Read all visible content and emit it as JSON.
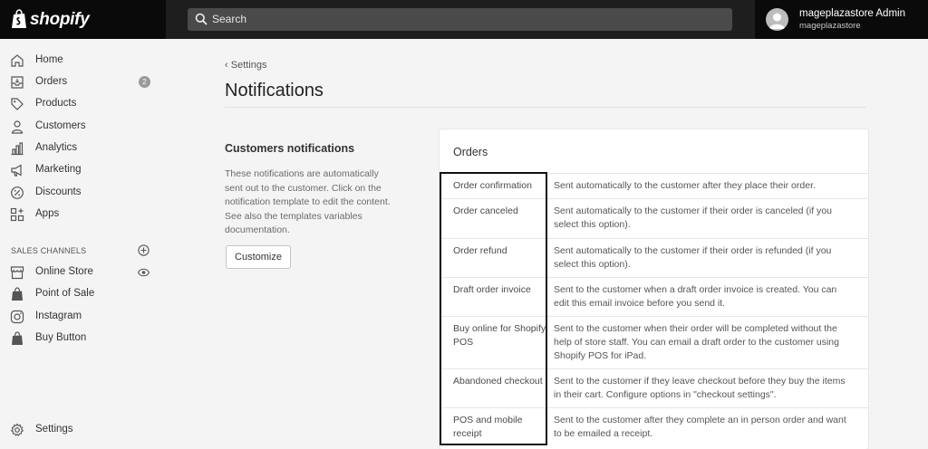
{
  "brand": {
    "name": "shopify"
  },
  "search": {
    "placeholder": "Search"
  },
  "user": {
    "name": "mageplazastore Admin",
    "store": "mageplazastore"
  },
  "sidebar": {
    "items": [
      {
        "label": "Home",
        "icon": "home-icon"
      },
      {
        "label": "Orders",
        "icon": "orders-icon",
        "badge": "2"
      },
      {
        "label": "Products",
        "icon": "tag-icon"
      },
      {
        "label": "Customers",
        "icon": "person-icon"
      },
      {
        "label": "Analytics",
        "icon": "bar-chart-icon"
      },
      {
        "label": "Marketing",
        "icon": "megaphone-icon"
      },
      {
        "label": "Discounts",
        "icon": "discount-icon"
      },
      {
        "label": "Apps",
        "icon": "apps-icon"
      }
    ],
    "sales_channels_label": "SALES CHANNELS",
    "channels": [
      {
        "label": "Online Store",
        "icon": "store-icon"
      },
      {
        "label": "Point of Sale",
        "icon": "pos-bag-icon"
      },
      {
        "label": "Instagram",
        "icon": "instagram-icon"
      },
      {
        "label": "Buy Button",
        "icon": "buy-button-icon"
      }
    ],
    "settings_label": "Settings"
  },
  "main": {
    "breadcrumb": "Settings",
    "title": "Notifications",
    "customers_section": {
      "title": "Customers notifications",
      "description": "These notifications are automatically sent out to the customer. Click on the notification template to edit the content. See also the templates variables documentation.",
      "customize_label": "Customize"
    },
    "orders_card": {
      "title": "Orders",
      "rows": [
        {
          "name": "Order confirmation",
          "desc": "Sent automatically to the customer after they place their order."
        },
        {
          "name": "Order canceled",
          "desc": "Sent automatically to the customer if their order is canceled (if you select this option)."
        },
        {
          "name": "Order refund",
          "desc": "Sent automatically to the customer if their order is refunded (if you select this option)."
        },
        {
          "name": "Draft order invoice",
          "desc": "Sent to the customer when a draft order invoice is created. You can edit this email invoice before you send it."
        },
        {
          "name": "Buy online for Shopify POS",
          "desc": "Sent to the customer when their order will be completed without the help of store staff. You can email a draft order to the customer using Shopify POS for iPad."
        },
        {
          "name": "Abandoned checkout",
          "desc": "Sent to the customer if they leave checkout before they buy the items in their cart. Configure options in \"checkout settings\"."
        },
        {
          "name": "POS and mobile receipt",
          "desc": "Sent to the customer after they complete an in person order and want to be emailed a receipt."
        }
      ]
    }
  }
}
